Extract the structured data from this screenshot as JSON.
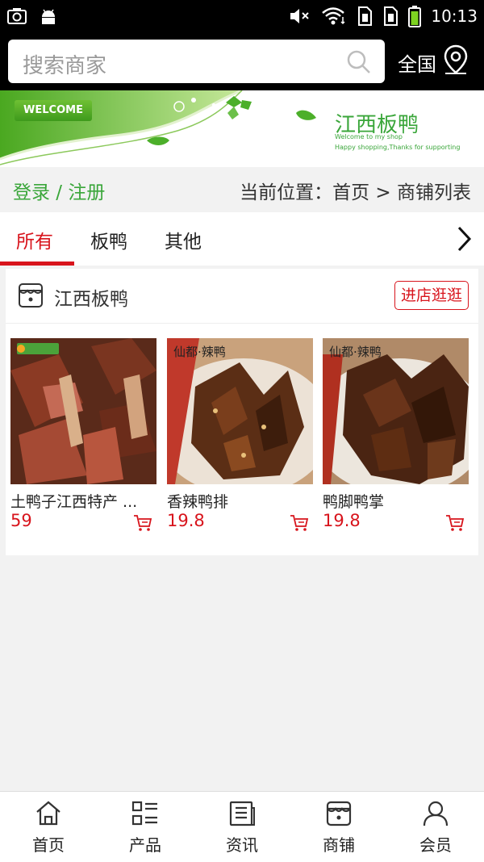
{
  "status_bar": {
    "time": "10:13"
  },
  "search": {
    "placeholder": "搜索商家",
    "region": "全国"
  },
  "banner": {
    "welcome": "WELCOME",
    "shop_title": "江西板鸭",
    "subtitle_1": "Welcome to my shop",
    "subtitle_2": "Happy shopping,Thanks for supporting"
  },
  "info_strip": {
    "login": "登录 / 注册",
    "breadcrumb": "当前位置：首页 > 商铺列表"
  },
  "tabs": [
    {
      "label": "所有"
    },
    {
      "label": "板鸭"
    },
    {
      "label": "其他"
    }
  ],
  "shop": {
    "name": "江西板鸭",
    "visit_label": "进店逛逛",
    "products": [
      {
        "name": "土鸭子江西特产 ...",
        "price": "59",
        "thumb_label": "fish-tag"
      },
      {
        "name": "香辣鸭排",
        "price": "19.8",
        "thumb_label": "仙都·辣鸭"
      },
      {
        "name": "鸭脚鸭掌",
        "price": "19.8",
        "thumb_label": "仙都·辣鸭"
      }
    ]
  },
  "bottom_nav": [
    {
      "label": "首页",
      "icon": "home-icon"
    },
    {
      "label": "产品",
      "icon": "list-icon"
    },
    {
      "label": "资讯",
      "icon": "news-icon"
    },
    {
      "label": "商铺",
      "icon": "store-icon"
    },
    {
      "label": "会员",
      "icon": "user-icon"
    }
  ],
  "colors": {
    "accent_red": "#d8141c",
    "accent_green": "#3aa63a"
  }
}
